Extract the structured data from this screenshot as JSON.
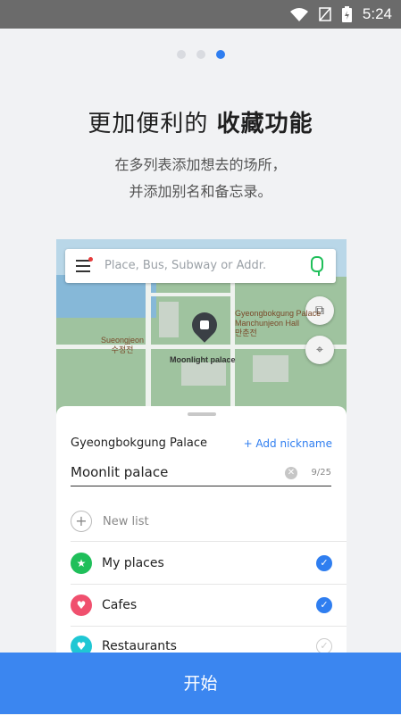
{
  "status_bar": {
    "time": "5:24"
  },
  "pager": {
    "total": 3,
    "active": 3
  },
  "headline": {
    "normal": "更加便利的",
    "bold": "收藏功能"
  },
  "subtitle": {
    "line1": "在多列表添加想去的场所，",
    "line2": "并添加别名和备忘录。"
  },
  "preview": {
    "search": {
      "placeholder": "Place, Bus, Subway or Addr."
    },
    "map_labels": {
      "gyeongbokgung": "Gyeongbokgung Palace",
      "manchunjeon": "Manchunjeon Hall",
      "manchunjeon_ko": "만춘전",
      "sueongjeon": "Sueongjeon",
      "sueongjeon_ko": "수정전",
      "moonlight": "Moonlight palace"
    },
    "sheet": {
      "place_name": "Gyeongbokgung Palace",
      "add_nickname": "+ Add nickname",
      "nickname_value": "Moonlit palace",
      "char_count": "9/25",
      "new_list_label": "New list",
      "lists": [
        {
          "label": "My places",
          "icon": "star-icon",
          "color": "#1fbf5a",
          "checked": true
        },
        {
          "label": "Cafes",
          "icon": "heart-icon",
          "color": "#f0506e",
          "checked": true
        },
        {
          "label": "Restaurants",
          "icon": "heart-icon",
          "color": "#1fc7d4",
          "checked": false
        }
      ]
    }
  },
  "start_button": {
    "label": "开始"
  },
  "colors": {
    "accent": "#3b86f0",
    "check": "#2f7ef0"
  }
}
